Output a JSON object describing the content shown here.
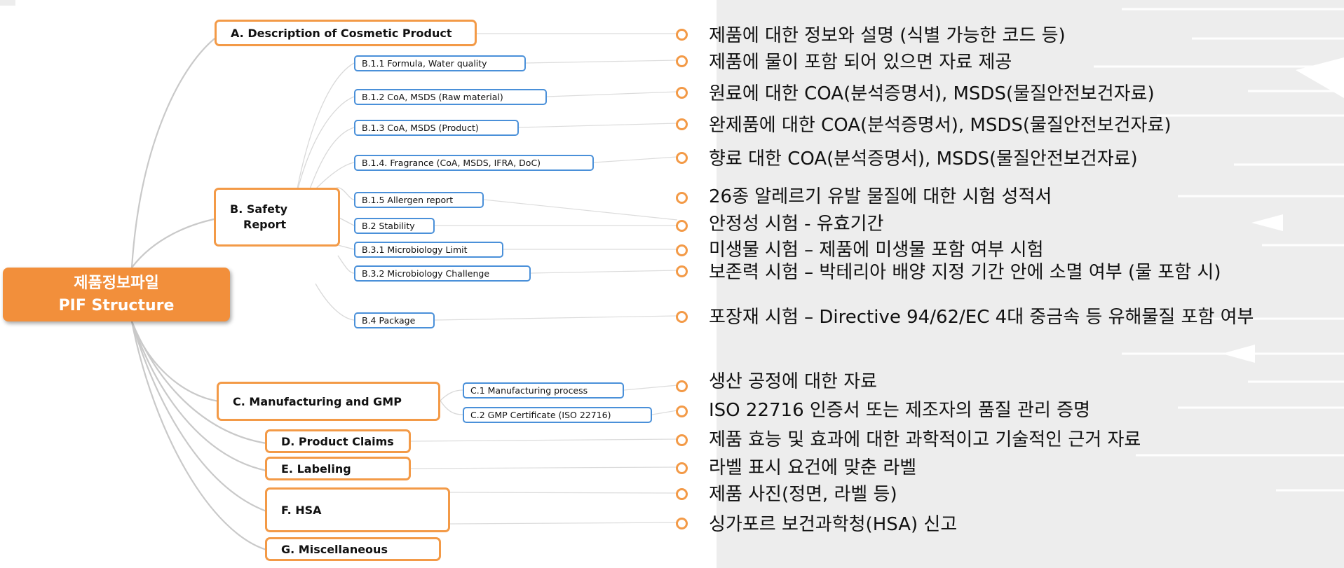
{
  "root": {
    "line1": "제품정보파일",
    "line2": "PIF Structure"
  },
  "sections": {
    "A": "A. Description of Cosmetic Product",
    "B_line1": "B. Safety",
    "B_line2": "Report",
    "C": "C. Manufacturing and GMP",
    "D": "D. Product Claims",
    "E": "E. Labeling",
    "F": "F. HSA",
    "G": "G. Miscellaneous"
  },
  "subitems": {
    "b11": "B.1.1 Formula, Water quality",
    "b12": "B.1.2 CoA, MSDS (Raw material)",
    "b13": "B.1.3 CoA, MSDS (Product)",
    "b14": "B.1.4. Fragrance (CoA, MSDS, IFRA, DoC)",
    "b15": "B.1.5 Allergen report",
    "b2": "B.2 Stability",
    "b31": "B.3.1 Microbiology Limit",
    "b32": "B.3.2 Microbiology Challenge",
    "b4": "B.4 Package",
    "c1": "C.1 Manufacturing process",
    "c2": "C.2 GMP Certificate (ISO 22716)"
  },
  "descriptions": [
    "제품에 대한 정보와 설명 (식별 가능한 코드 등)",
    "제품에 물이 포함 되어 있으면 자료 제공",
    "원료에 대한 COA(분석증명서), MSDS(물질안전보건자료)",
    "완제품에 대한 COA(분석증명서), MSDS(물질안전보건자료)",
    "향료 대한 COA(분석증명서), MSDS(물질안전보건자료)",
    "26종 알레르기 유발 물질에 대한 시험 성적서",
    "안정성 시험 - 유효기간",
    "미생물 시험 – 제품에 미생물 포함 여부 시험",
    "보존력 시험 – 박테리아 배양 지정 기간 안에 소멸 여부 (물 포함 시)",
    "포장재 시험 – Directive 94/62/EC 4대 중금속 등 유해물질 포함 여부",
    "생산 공정에 대한 자료",
    "ISO 22716 인증서 또는 제조자의 품질 관리 증명",
    "제품 효능 및 효과에 대한 과학적이고 기술적인 근거 자료",
    "라벨 표시 요건에 맞춘 라벨",
    "제품 사진(정면, 라벨 등)",
    "싱가포르 보건과학청(HSA) 신고"
  ],
  "colors": {
    "accent": "#f28f3b",
    "branch": "#c8c8c8",
    "blue_border": "#4a90d9"
  }
}
